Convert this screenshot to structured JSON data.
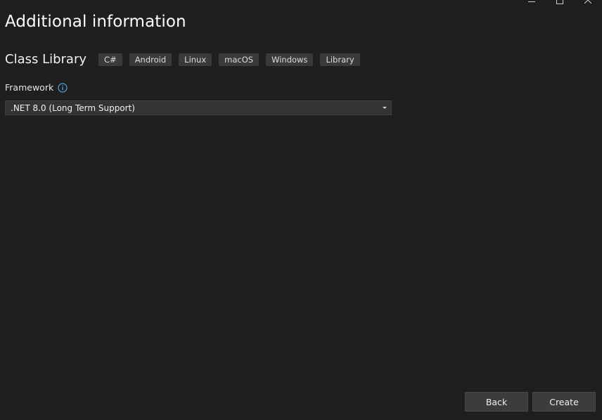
{
  "window": {
    "controls": [
      "minimize",
      "maximize",
      "close"
    ]
  },
  "header": {
    "title": "Additional information"
  },
  "template": {
    "name": "Class Library",
    "tags": [
      "C#",
      "Android",
      "Linux",
      "macOS",
      "Windows",
      "Library"
    ]
  },
  "framework": {
    "label": "Framework",
    "selected": ".NET 8.0 (Long Term Support)",
    "info_icon": "info-icon"
  },
  "footer": {
    "back_label": "Back",
    "create_label": "Create"
  },
  "colors": {
    "background": "#1f1f1f",
    "tag_background": "#3a3a3a",
    "dropdown_background": "#333333",
    "button_background": "#3c3c3c",
    "info_accent": "#4fa8e0"
  }
}
